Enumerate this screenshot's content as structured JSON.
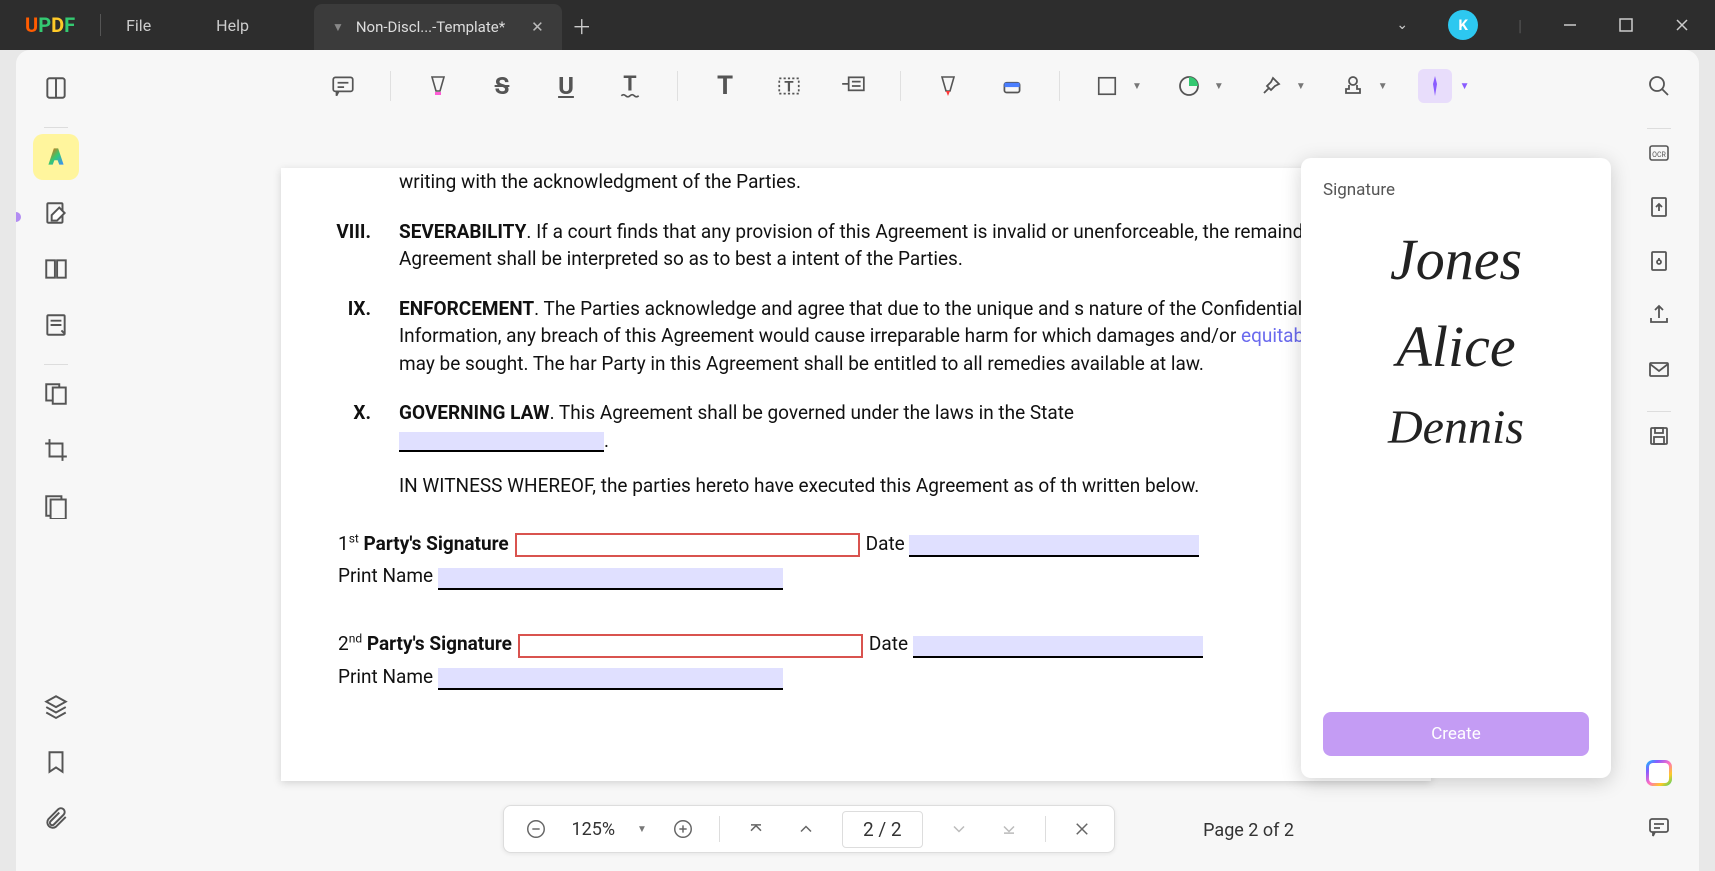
{
  "titlebar": {
    "brand": "UPDF",
    "menu": {
      "file": "File",
      "help": "Help"
    },
    "tab": {
      "title": "Non-Discl...-Template*"
    },
    "avatar": "K"
  },
  "toolbar": {
    "items": [
      "comment",
      "highlight",
      "strikethrough",
      "underline",
      "squiggly",
      "text",
      "textbox",
      "note",
      "pencil",
      "eraser",
      "rectangle",
      "circle",
      "pin",
      "stamp",
      "signature"
    ]
  },
  "left_tools": [
    "thumbnails",
    "annotate",
    "edit",
    "organize",
    "form",
    "compare",
    "crop",
    "compress"
  ],
  "left_bottom": [
    "layers",
    "bookmark",
    "attachment"
  ],
  "right_tools": [
    "search",
    "ocr",
    "convert",
    "protect",
    "share",
    "email"
  ],
  "right_extra": [
    "save"
  ],
  "document": {
    "line0": "writing with the acknowledgment of the Parties.",
    "c8": {
      "num": "VIII.",
      "title": "SEVERABILITY",
      "text": ". If a court finds that any provision of this Agreement is invalid or unenforceable, the remainder of this Agreement shall be interpreted so as to best a intent of the Parties."
    },
    "c9": {
      "num": "IX.",
      "title": "ENFORCEMENT",
      "text1": ". The Parties acknowledge and agree that due to the unique and s nature of the Confidential Information, any breach of this Agreement would cause irreparable harm for which damages and/or ",
      "eq": "equitable",
      "text2": " relief may be sought. The har Party in this Agreement shall be entitled to all remedies available at law."
    },
    "c10": {
      "num": "X.",
      "title": "GOVERNING LAW",
      "text": ". This Agreement shall be governed under the laws in the State "
    },
    "witness": "IN WITNESS WHEREOF, the parties hereto have executed this Agreement as of th written below.",
    "sig1": {
      "label": "1",
      "sup": "st",
      "rest": " Party's Signature",
      "date": "Date",
      "print": "Print Name"
    },
    "sig2": {
      "label": "2",
      "sup": "nd",
      "rest": " Party's Signature",
      "date": "Date",
      "print": "Print Name"
    }
  },
  "sig_panel": {
    "title": "Signature",
    "items": [
      "Jones",
      "Alice",
      "Dennis"
    ],
    "create": "Create"
  },
  "nav": {
    "zoom": "125%",
    "page_input": "2  /  2",
    "page_label": "Page 2 of 2"
  }
}
